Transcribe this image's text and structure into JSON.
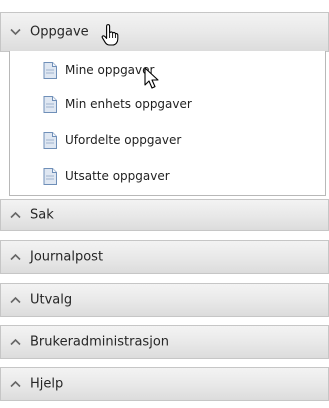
{
  "sections": [
    {
      "label": "Oppgave",
      "expanded": true,
      "items": [
        {
          "label": "Mine oppgaver",
          "icon": "document-icon"
        },
        {
          "label": "Min enhets oppgaver",
          "icon": "document-icon"
        },
        {
          "label": "Ufordelte oppgaver",
          "icon": "document-icon"
        },
        {
          "label": "Utsatte oppgaver",
          "icon": "document-icon"
        }
      ]
    },
    {
      "label": "Sak",
      "expanded": false
    },
    {
      "label": "Journalpost",
      "expanded": false
    },
    {
      "label": "Utvalg",
      "expanded": false
    },
    {
      "label": "Brukeradministrasjon",
      "expanded": false
    },
    {
      "label": "Hjelp",
      "expanded": false
    }
  ],
  "colors": {
    "header_text": "#262626",
    "chevron": "#666666",
    "doc_icon_fill": "#dfe7f2",
    "doc_icon_stroke": "#6f8fb8"
  },
  "icons": {
    "expanded_chevron": "chevron-down-icon",
    "collapsed_chevron": "chevron-up-icon",
    "cursors": [
      "hand-pointer-cursor",
      "arrow-pointer-cursor"
    ]
  }
}
